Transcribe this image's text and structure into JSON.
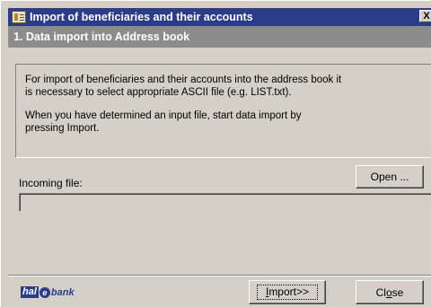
{
  "window": {
    "title": "Import of beneficiaries and their accounts",
    "close_glyph": "X",
    "icon": "app-icon"
  },
  "step": {
    "title": "1. Data import into Address book"
  },
  "info": {
    "paragraph1": "For import of beneficiaries and their accounts into the address book it\nis necessary to select appropriate ASCII file (e.g. LIST.txt).",
    "paragraph2": "When you have determined an input file, start data import by\npressing Import."
  },
  "incoming": {
    "label": "Incoming file:",
    "value": ""
  },
  "buttons": {
    "open": "Open ...",
    "import_underlined": "I",
    "import_rest": "mport>>",
    "close_prefix": "Cl",
    "close_underlined": "o",
    "close_suffix": "se"
  },
  "logo": {
    "part1": "hal",
    "part2": "e",
    "part3": "bank"
  },
  "colors": {
    "titlebar": "#2b3c88",
    "stepbar": "#8c8c8c",
    "face": "#d4d0c8"
  }
}
